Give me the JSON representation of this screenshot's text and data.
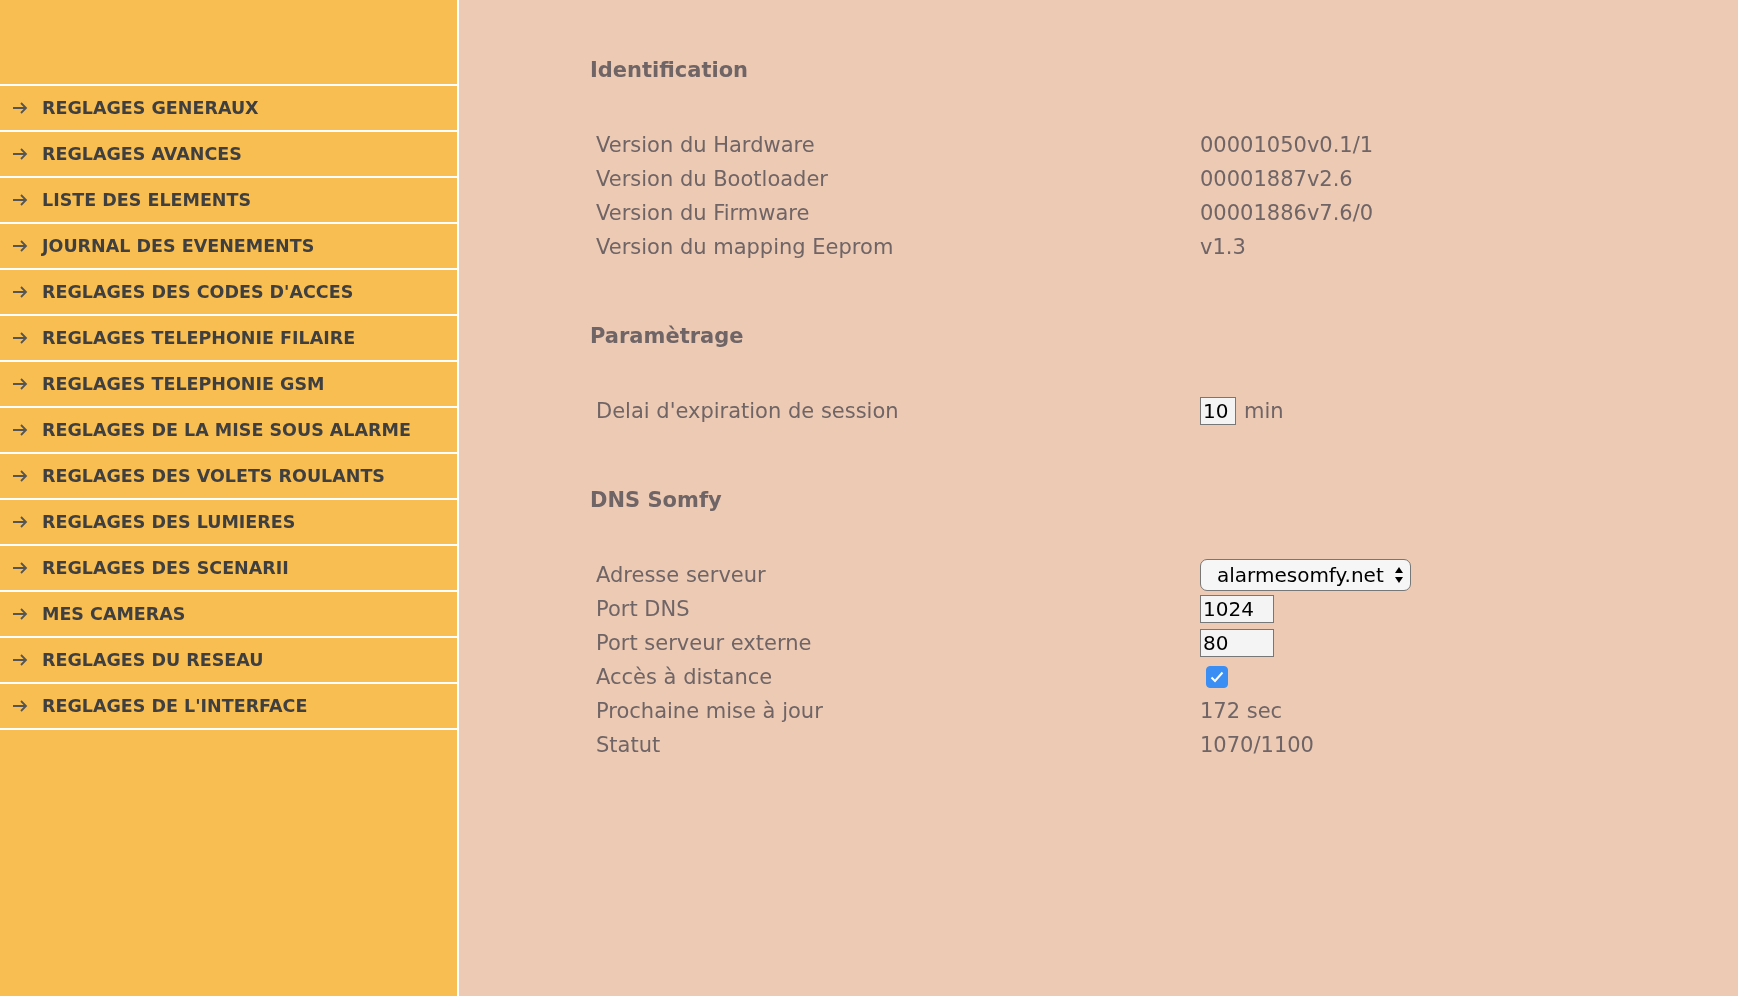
{
  "sidebar": {
    "items": [
      {
        "label": "REGLAGES GENERAUX",
        "selected": false
      },
      {
        "label": "REGLAGES AVANCES",
        "selected": false
      },
      {
        "label": "LISTE DES ELEMENTS",
        "selected": false
      },
      {
        "label": "JOURNAL DES EVENEMENTS",
        "selected": false
      },
      {
        "label": "REGLAGES DES CODES D'ACCES",
        "selected": false
      },
      {
        "label": "REGLAGES TELEPHONIE FILAIRE",
        "selected": false
      },
      {
        "label": "REGLAGES TELEPHONIE GSM",
        "selected": false
      },
      {
        "label": "REGLAGES DE LA MISE SOUS ALARME",
        "selected": false
      },
      {
        "label": "REGLAGES DES VOLETS ROULANTS",
        "selected": false
      },
      {
        "label": "REGLAGES DES LUMIERES",
        "selected": false
      },
      {
        "label": "REGLAGES DES SCENARII",
        "selected": false
      },
      {
        "label": "MES CAMERAS",
        "selected": false
      },
      {
        "label": "REGLAGES DU RESEAU",
        "selected": false
      },
      {
        "label": "REGLAGES DE L'INTERFACE",
        "selected": false
      }
    ]
  },
  "sections": [
    {
      "title": "Identification",
      "rows": [
        {
          "kind": "text",
          "label": "Version du Hardware",
          "value": "00001050v0.1/1"
        },
        {
          "kind": "text",
          "label": "Version du Bootloader",
          "value": "00001887v2.6"
        },
        {
          "kind": "text",
          "label": "Version du Firmware",
          "value": "00001886v7.6/0"
        },
        {
          "kind": "text",
          "label": "Version du mapping Eeprom",
          "value": "v1.3"
        }
      ]
    },
    {
      "title": "Paramètrage",
      "rows": [
        {
          "kind": "input",
          "label": "Delai d'expiration de session",
          "value": "10",
          "unit": "min"
        }
      ]
    },
    {
      "title": "DNS Somfy",
      "rows": [
        {
          "kind": "select",
          "label": "Adresse serveur",
          "value": "alarmesomfy.net"
        },
        {
          "kind": "input",
          "label": "Port DNS",
          "value": "1024"
        },
        {
          "kind": "input",
          "label": "Port serveur externe",
          "value": "80"
        },
        {
          "kind": "checkbox",
          "label": "Accès à distance",
          "checked": true
        },
        {
          "kind": "text",
          "label": "Prochaine mise à jour",
          "value": "172 sec"
        },
        {
          "kind": "text",
          "label": "Statut",
          "value": "1070/1100"
        }
      ]
    }
  ]
}
